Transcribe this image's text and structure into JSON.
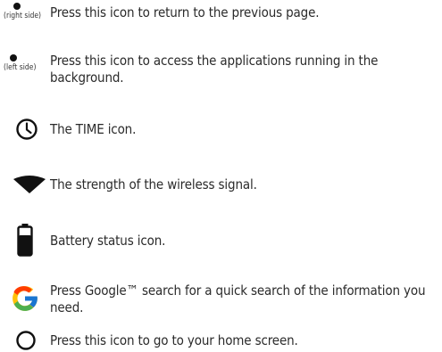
{
  "items": [
    {
      "icon": "dot-icon",
      "side_label": "(right side)",
      "text": "Press this icon to return to the previous page."
    },
    {
      "icon": "dot-icon",
      "side_label": "(left side)",
      "text": "Press this icon to access the applications running in the background."
    },
    {
      "icon": "clock-icon",
      "text": "The TIME icon."
    },
    {
      "icon": "wifi-signal-icon",
      "text": "The strength of the wireless signal."
    },
    {
      "icon": "battery-icon",
      "text": "Battery status icon."
    },
    {
      "icon": "google-g-icon",
      "text": "Press Google™ search for a quick search of the information you need."
    },
    {
      "icon": "circle-home-icon",
      "text": "Press this icon to go to your home screen."
    }
  ]
}
